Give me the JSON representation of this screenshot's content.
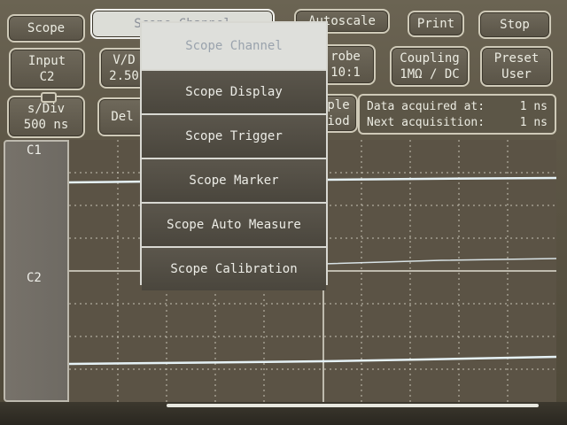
{
  "buttons": {
    "scope": "Scope",
    "scope_channel": "Scope Channel",
    "autoscale": "Autoscale",
    "print": "Print",
    "stop": "Stop"
  },
  "row2": {
    "input_top": "Input",
    "input_bottom": "C2",
    "vdiv_top": "V/D",
    "vdiv_bottom": "2.50",
    "probe_top": "robe",
    "probe_bottom": "10:1",
    "coupling_top": "Coupling",
    "coupling_bottom": "1MΩ / DC",
    "preset_top": "Preset",
    "preset_bottom": "User"
  },
  "row3": {
    "sdiv_top": "s/Div",
    "sdiv_bottom": "500 ns",
    "delay": "Del",
    "sample_top": "ple",
    "sample_bottom": "iod",
    "data_acquired_label": "Data acquired at:",
    "data_acquired_value": "1 ns",
    "next_acq_label": "Next acquisition:",
    "next_acq_value": "1 ns"
  },
  "channels": {
    "c1": "C1",
    "c2": "C2"
  },
  "menu": {
    "title": "Scope Channel",
    "items": [
      "Scope Display",
      "Scope Trigger",
      "Scope Marker",
      "Scope Auto Measure",
      "Scope Calibration"
    ]
  },
  "colors": {
    "trace": "#e6f2f6",
    "grid": "#d9d6c8",
    "screen_bg": "#5a5243"
  }
}
